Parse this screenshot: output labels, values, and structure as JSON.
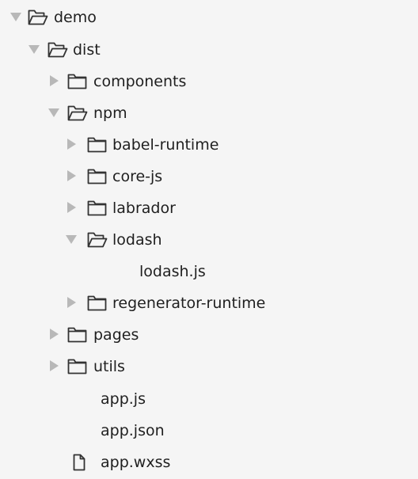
{
  "tree": {
    "demo": "demo",
    "dist": "dist",
    "components": "components",
    "npm": "npm",
    "babel_runtime": "babel-runtime",
    "core_js": "core-js",
    "labrador": "labrador",
    "lodash": "lodash",
    "lodash_js": "lodash.js",
    "regenerator_runtime": "regenerator-runtime",
    "pages": "pages",
    "utils": "utils",
    "app_js": "app.js",
    "app_json": "app.json",
    "app_wxss": "app.wxss"
  },
  "colors": {
    "background": "#f5f5f5",
    "arrow": "#b8b8b8",
    "icon": "#333333",
    "text": "#1f1f1f"
  }
}
